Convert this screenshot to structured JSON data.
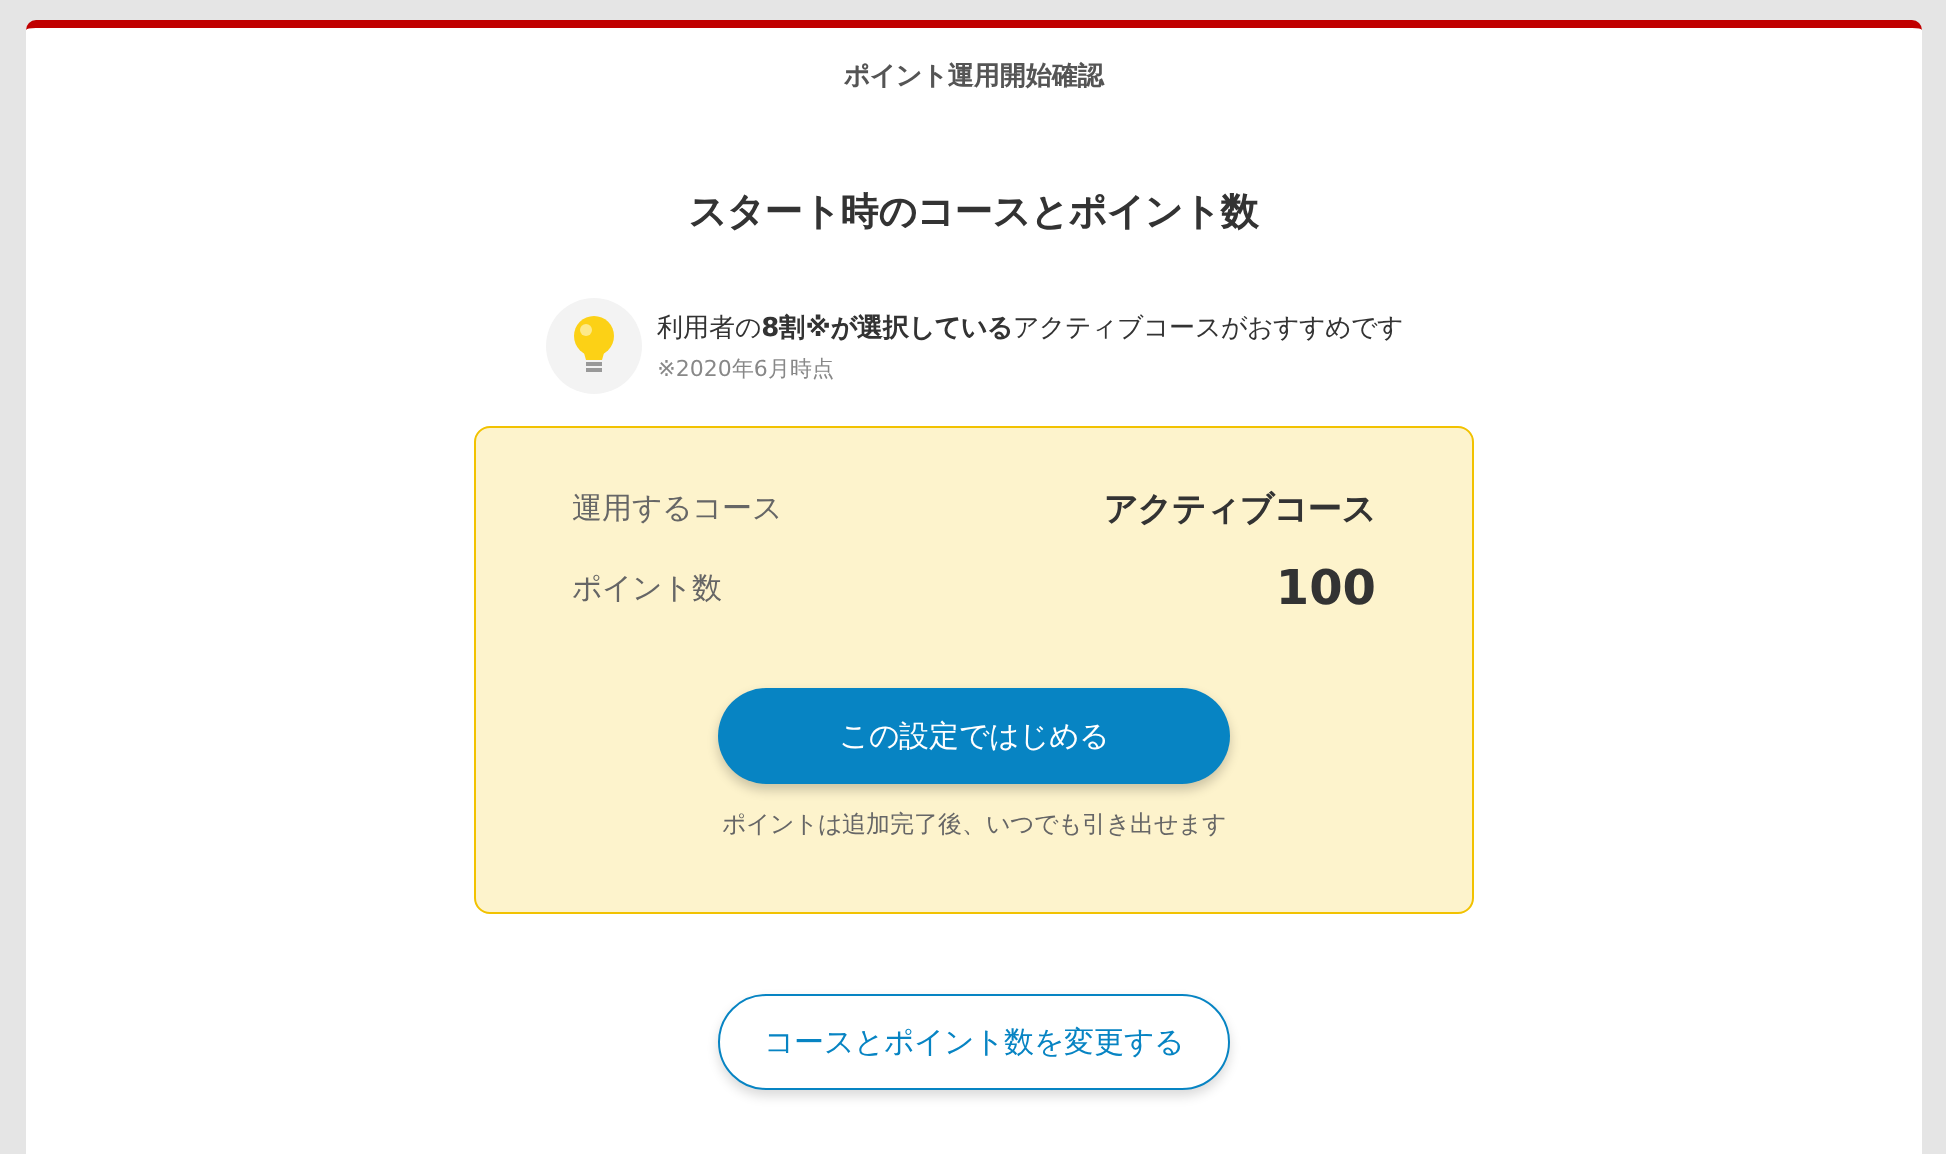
{
  "header": {
    "title": "ポイント運用開始確認"
  },
  "heading": "スタート時のコースとポイント数",
  "tip": {
    "text": "利用者の**8割※が選択している**アクティブコースがおすすめです",
    "note": "※2020年6月時点"
  },
  "summary": {
    "rows": [
      {
        "label": "運用するコース",
        "value": "アクティブコース",
        "kind": "text"
      },
      {
        "label": "ポイント数",
        "value": "100",
        "kind": "number"
      }
    ],
    "primary_button": "この設定ではじめる",
    "note": "ポイントは追加完了後、いつでも引き出せます"
  },
  "secondary_button": "コースとポイント数を変更する"
}
